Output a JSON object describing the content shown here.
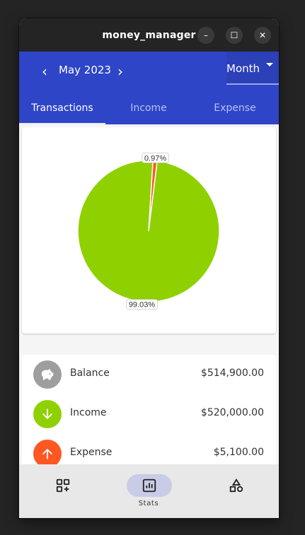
{
  "window": {
    "title": "money_manager",
    "minimize_glyph": "–",
    "maximize_glyph": "☐",
    "close_glyph": "✕"
  },
  "header": {
    "prev_glyph": "‹",
    "next_glyph": "›",
    "month": "May 2023",
    "period": "Month",
    "color": "#2f45c8"
  },
  "tabs": [
    {
      "label": "Transactions",
      "active": true
    },
    {
      "label": "Income",
      "active": false
    },
    {
      "label": "Expense",
      "active": false
    }
  ],
  "chart_data": {
    "type": "pie",
    "slices": [
      {
        "label": "99.03%",
        "value": 99.03,
        "color": "#8fd100"
      },
      {
        "label": "0.97%",
        "value": 0.97,
        "color": "#ff5722"
      }
    ]
  },
  "summary": [
    {
      "label": "Balance",
      "value": "$514,900.00",
      "icon": "piggy-bank-icon",
      "color": "#9e9e9e"
    },
    {
      "label": "Income",
      "value": "$520,000.00",
      "icon": "arrow-down-icon",
      "color": "#8fd100"
    },
    {
      "label": "Expense",
      "value": "$5,100.00",
      "icon": "arrow-up-icon",
      "color": "#ff5722"
    }
  ],
  "bottom_nav": [
    {
      "label": "",
      "icon": "add-widget-icon",
      "active": false
    },
    {
      "label": "Stats",
      "icon": "stats-icon",
      "active": true
    },
    {
      "label": "",
      "icon": "shapes-icon",
      "active": false
    }
  ]
}
